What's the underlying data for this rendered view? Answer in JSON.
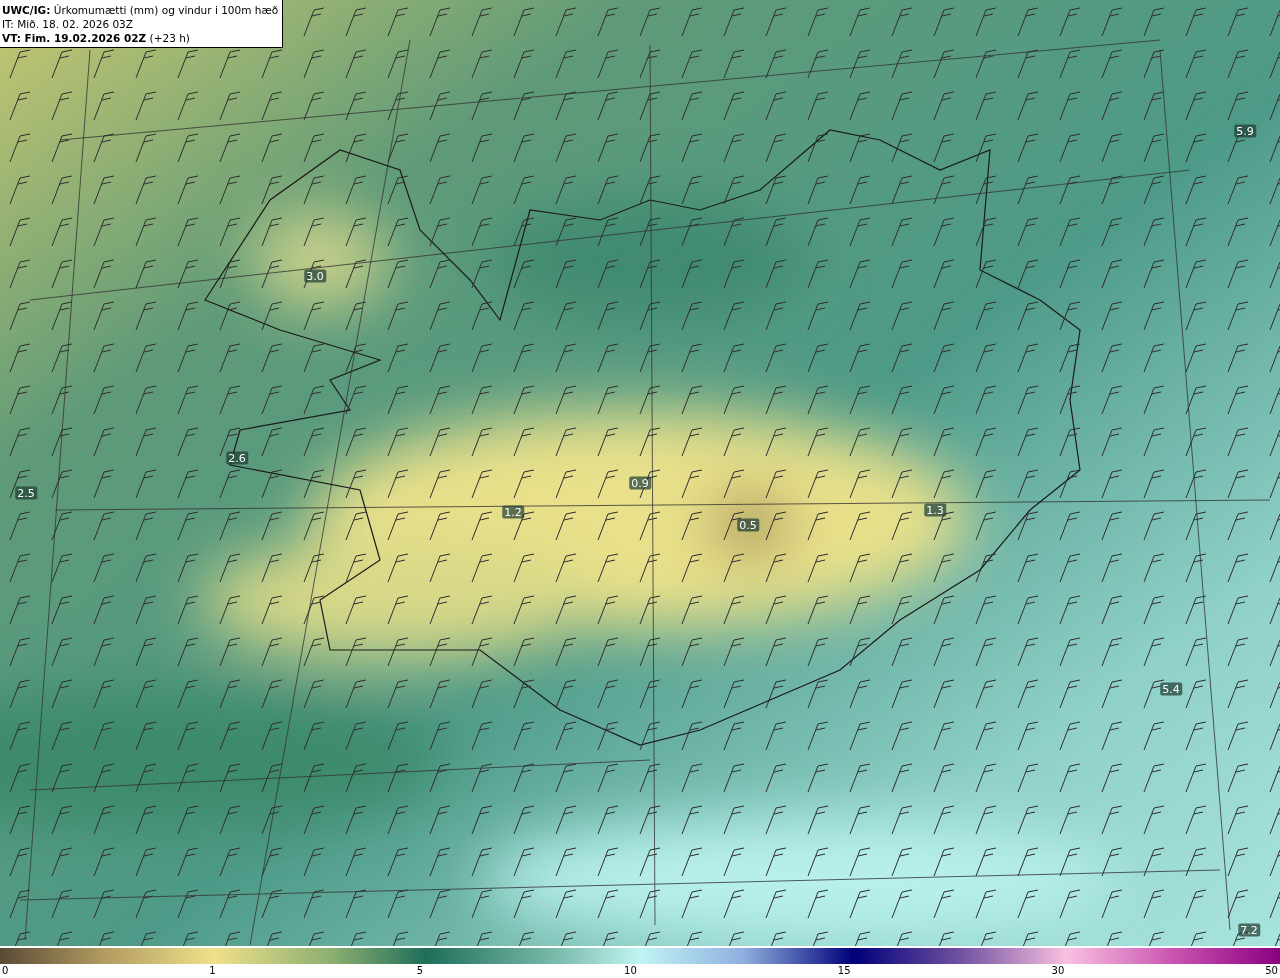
{
  "header": {
    "title": "**UWC/IG:** Úrkomumætti (mm) og vindur i 100m hæð",
    "initial_time": "IT: Mið. 18. 02. 2026 03Z",
    "valid_time": "**VT: Fim. 19.02.2026 02Z** (+23 h)"
  },
  "map_values": [
    "5.9",
    "3.0",
    "2.6",
    "0.9",
    "2.5",
    "1.3",
    "1.2",
    "0.5",
    "5.4",
    "7.2"
  ],
  "colorbar": {
    "ticks": [
      "0",
      "1",
      "5",
      "10",
      "15",
      "30",
      "50"
    ]
  }
}
